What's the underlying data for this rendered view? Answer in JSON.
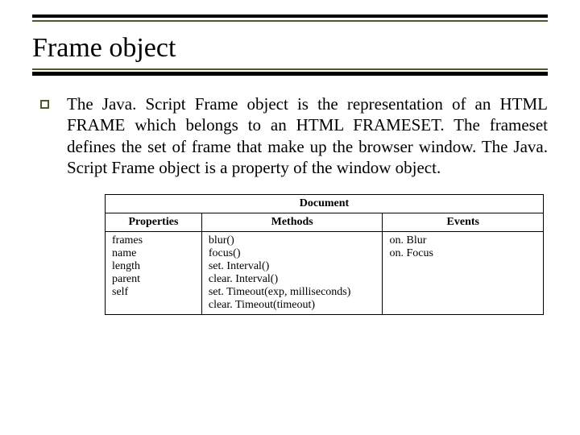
{
  "title": "Frame object",
  "paragraph": "The Java. Script Frame object is the representation of an HTML FRAME which belongs to an HTML FRAMESET. The frameset defines the set of frame that make up the browser window. The Java. Script Frame object is a property of the window object.",
  "table": {
    "spanHeader": "Document",
    "headers": {
      "c1": "Properties",
      "c2": "Methods",
      "c3": "Events"
    },
    "col1": [
      "frames",
      "name",
      "length",
      "parent",
      "self"
    ],
    "col2": [
      "blur()",
      "focus()",
      "set. Interval()",
      "clear. Interval()",
      "set. Timeout(exp, milliseconds)",
      "clear. Timeout(timeout)"
    ],
    "col3": [
      "on. Blur",
      "on. Focus"
    ]
  }
}
